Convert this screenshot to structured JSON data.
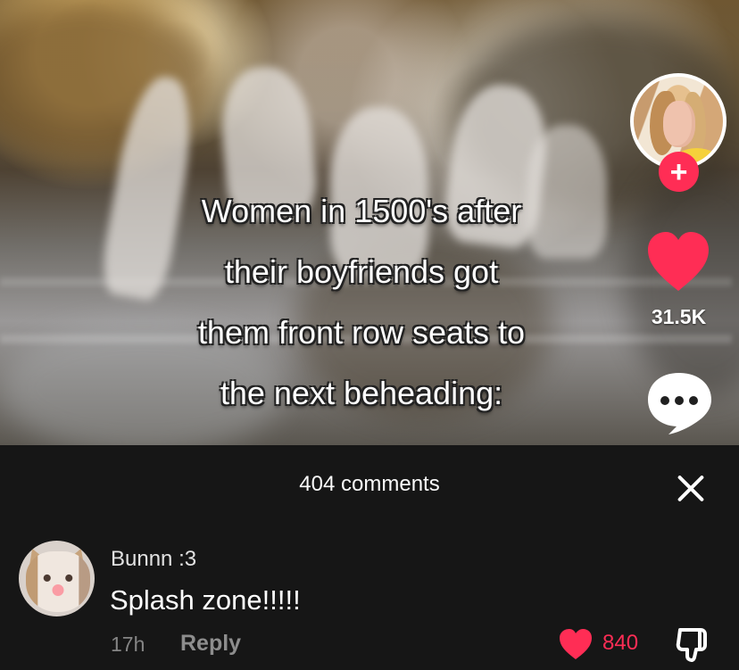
{
  "video": {
    "caption_lines": [
      "Women in 1500's after",
      "their boyfriends got",
      "them front row seats to",
      "the next beheading:"
    ],
    "actions": {
      "like_count": "31.5K"
    }
  },
  "comments_panel": {
    "title": "404 comments",
    "items": [
      {
        "username": "Bunnn :3",
        "text": "Splash zone!!!!!",
        "time": "17h",
        "reply_label": "Reply",
        "like_count": "840"
      }
    ]
  },
  "icons": {
    "profile": "avatar",
    "follow": "plus-icon",
    "like": "heart-icon",
    "comment": "comment-icon",
    "close": "close-icon",
    "comment_like": "heart-icon",
    "dislike": "thumb-down-icon"
  },
  "colors": {
    "panel_background": "#161616",
    "primary_text": "#ffffff",
    "muted_text": "#8d8d8d",
    "accent_red": "#ff2d55"
  }
}
